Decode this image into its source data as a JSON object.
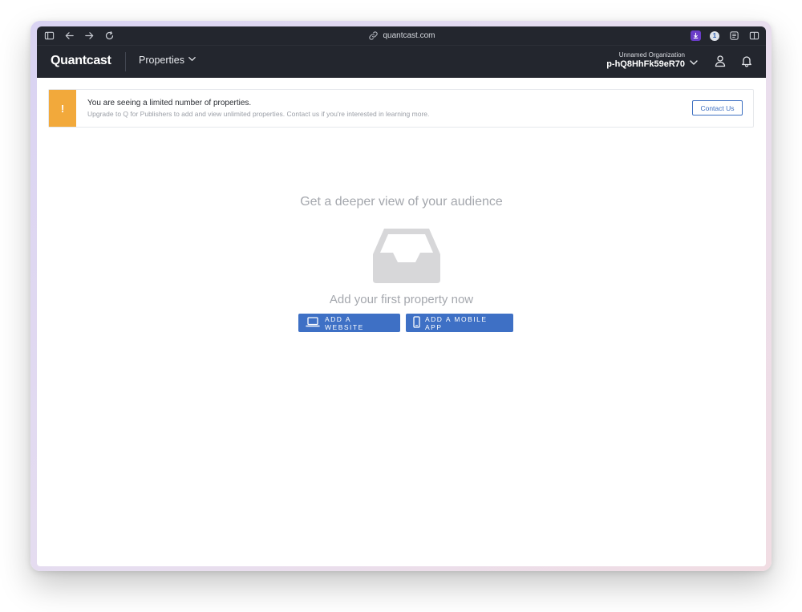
{
  "browser": {
    "url": "quantcast.com",
    "icons": [
      "sidebar-icon",
      "back-arrow-icon",
      "forward-arrow-icon",
      "reload-icon",
      "link-icon",
      "download-extension-icon",
      "password-manager-icon",
      "reader-icon",
      "split-view-icon"
    ],
    "extension_1p_label": "1"
  },
  "header": {
    "logo": "Quantcast",
    "nav_label": "Properties",
    "org_name": "Unnamed Organization",
    "org_id": "p-hQ8HhFk59eR70"
  },
  "banner": {
    "flag": "!",
    "title": "You are seeing a limited number of properties.",
    "subtitle": "Upgrade to Q for Publishers to add and view unlimited properties. Contact us if you're interested in learning more.",
    "button_label": "Contact Us"
  },
  "empty_state": {
    "title": "Get a deeper view of your audience",
    "subtitle": "Add your first property now",
    "add_website_label": "ADD A WEBSITE",
    "add_app_label": "ADD A MOBILE APP"
  },
  "colors": {
    "header_bg": "#23262e",
    "accent_blue": "#3e70c5",
    "warning_orange": "#f2a93b",
    "muted_text": "#a4a7ad"
  }
}
